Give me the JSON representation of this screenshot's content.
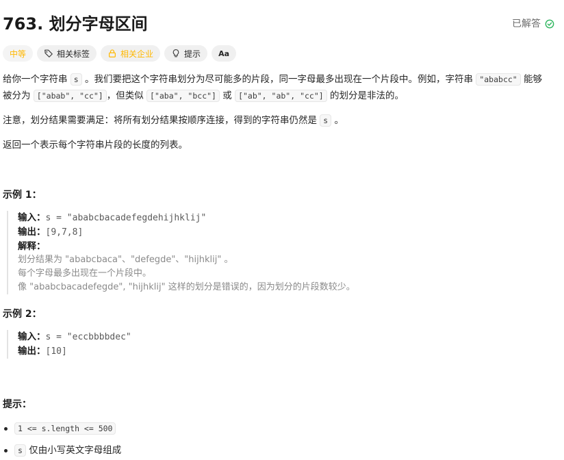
{
  "problem": {
    "title": "763. 划分字母区间",
    "solved_label": "已解答",
    "accent_solved": "#2db55d"
  },
  "tags": {
    "difficulty": "中等",
    "related_tags": "相关标签",
    "related_companies": "相关企业",
    "hints": "提示",
    "font_toggle": "Aa"
  },
  "description": {
    "p1_a": "给你一个字符串 ",
    "p1_code_s": "s",
    "p1_b": " 。我们要把这个字符串划分为尽可能多的片段，同一字母最多出现在一个片段中。例如，字符串 ",
    "p1_code_ex": "\"ababcc\"",
    "p1_c": " 能够",
    "p1_d": "被分为 ",
    "p1_code_ok": "[\"abab\", \"cc\"]",
    "p1_e": "，但类似 ",
    "p1_code_bad1": "[\"aba\", \"bcc\"]",
    "p1_f": " 或 ",
    "p1_code_bad2": "[\"ab\", \"ab\", \"cc\"]",
    "p1_g": " 的划分是非法的。",
    "p2_a": "注意，划分结果需要满足：将所有划分结果按顺序连接，得到的字符串仍然是 ",
    "p2_code": "s",
    "p2_b": " 。",
    "p3": "返回一个表示每个字符串片段的长度的列表。"
  },
  "examples": [
    {
      "heading": "示例 1：",
      "input_label": "输入：",
      "input_value": "s = \"ababcbacadefegdehijhklij\"",
      "output_label": "输出：",
      "output_value": "[9,7,8]",
      "explain_label": "解释：",
      "explain_lines": [
        "划分结果为 \"ababcbaca\"、\"defegde\"、\"hijhklij\" 。",
        "每个字母最多出现在一个片段中。",
        "像 \"ababcbacadefegde\", \"hijhklij\" 这样的划分是错误的，因为划分的片段数较少。"
      ]
    },
    {
      "heading": "示例 2：",
      "input_label": "输入：",
      "input_value": "s = \"eccbbbbdec\"",
      "output_label": "输出：",
      "output_value": "[10]"
    }
  ],
  "constraints": {
    "heading": "提示：",
    "items": [
      {
        "code": "1 <= s.length <= 500",
        "text": ""
      },
      {
        "code": "s",
        "text": " 仅由小写英文字母组成"
      }
    ]
  }
}
